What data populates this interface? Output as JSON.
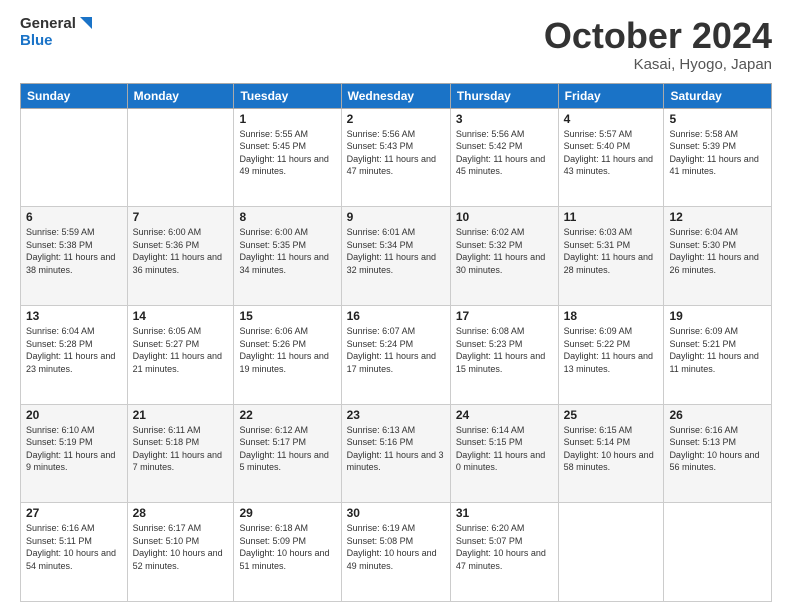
{
  "header": {
    "logo_line1": "General",
    "logo_line2": "Blue",
    "month": "October 2024",
    "location": "Kasai, Hyogo, Japan"
  },
  "weekdays": [
    "Sunday",
    "Monday",
    "Tuesday",
    "Wednesday",
    "Thursday",
    "Friday",
    "Saturday"
  ],
  "weeks": [
    [
      {
        "day": "",
        "sunrise": "",
        "sunset": "",
        "daylight": ""
      },
      {
        "day": "",
        "sunrise": "",
        "sunset": "",
        "daylight": ""
      },
      {
        "day": "1",
        "sunrise": "Sunrise: 5:55 AM",
        "sunset": "Sunset: 5:45 PM",
        "daylight": "Daylight: 11 hours and 49 minutes."
      },
      {
        "day": "2",
        "sunrise": "Sunrise: 5:56 AM",
        "sunset": "Sunset: 5:43 PM",
        "daylight": "Daylight: 11 hours and 47 minutes."
      },
      {
        "day": "3",
        "sunrise": "Sunrise: 5:56 AM",
        "sunset": "Sunset: 5:42 PM",
        "daylight": "Daylight: 11 hours and 45 minutes."
      },
      {
        "day": "4",
        "sunrise": "Sunrise: 5:57 AM",
        "sunset": "Sunset: 5:40 PM",
        "daylight": "Daylight: 11 hours and 43 minutes."
      },
      {
        "day": "5",
        "sunrise": "Sunrise: 5:58 AM",
        "sunset": "Sunset: 5:39 PM",
        "daylight": "Daylight: 11 hours and 41 minutes."
      }
    ],
    [
      {
        "day": "6",
        "sunrise": "Sunrise: 5:59 AM",
        "sunset": "Sunset: 5:38 PM",
        "daylight": "Daylight: 11 hours and 38 minutes."
      },
      {
        "day": "7",
        "sunrise": "Sunrise: 6:00 AM",
        "sunset": "Sunset: 5:36 PM",
        "daylight": "Daylight: 11 hours and 36 minutes."
      },
      {
        "day": "8",
        "sunrise": "Sunrise: 6:00 AM",
        "sunset": "Sunset: 5:35 PM",
        "daylight": "Daylight: 11 hours and 34 minutes."
      },
      {
        "day": "9",
        "sunrise": "Sunrise: 6:01 AM",
        "sunset": "Sunset: 5:34 PM",
        "daylight": "Daylight: 11 hours and 32 minutes."
      },
      {
        "day": "10",
        "sunrise": "Sunrise: 6:02 AM",
        "sunset": "Sunset: 5:32 PM",
        "daylight": "Daylight: 11 hours and 30 minutes."
      },
      {
        "day": "11",
        "sunrise": "Sunrise: 6:03 AM",
        "sunset": "Sunset: 5:31 PM",
        "daylight": "Daylight: 11 hours and 28 minutes."
      },
      {
        "day": "12",
        "sunrise": "Sunrise: 6:04 AM",
        "sunset": "Sunset: 5:30 PM",
        "daylight": "Daylight: 11 hours and 26 minutes."
      }
    ],
    [
      {
        "day": "13",
        "sunrise": "Sunrise: 6:04 AM",
        "sunset": "Sunset: 5:28 PM",
        "daylight": "Daylight: 11 hours and 23 minutes."
      },
      {
        "day": "14",
        "sunrise": "Sunrise: 6:05 AM",
        "sunset": "Sunset: 5:27 PM",
        "daylight": "Daylight: 11 hours and 21 minutes."
      },
      {
        "day": "15",
        "sunrise": "Sunrise: 6:06 AM",
        "sunset": "Sunset: 5:26 PM",
        "daylight": "Daylight: 11 hours and 19 minutes."
      },
      {
        "day": "16",
        "sunrise": "Sunrise: 6:07 AM",
        "sunset": "Sunset: 5:24 PM",
        "daylight": "Daylight: 11 hours and 17 minutes."
      },
      {
        "day": "17",
        "sunrise": "Sunrise: 6:08 AM",
        "sunset": "Sunset: 5:23 PM",
        "daylight": "Daylight: 11 hours and 15 minutes."
      },
      {
        "day": "18",
        "sunrise": "Sunrise: 6:09 AM",
        "sunset": "Sunset: 5:22 PM",
        "daylight": "Daylight: 11 hours and 13 minutes."
      },
      {
        "day": "19",
        "sunrise": "Sunrise: 6:09 AM",
        "sunset": "Sunset: 5:21 PM",
        "daylight": "Daylight: 11 hours and 11 minutes."
      }
    ],
    [
      {
        "day": "20",
        "sunrise": "Sunrise: 6:10 AM",
        "sunset": "Sunset: 5:19 PM",
        "daylight": "Daylight: 11 hours and 9 minutes."
      },
      {
        "day": "21",
        "sunrise": "Sunrise: 6:11 AM",
        "sunset": "Sunset: 5:18 PM",
        "daylight": "Daylight: 11 hours and 7 minutes."
      },
      {
        "day": "22",
        "sunrise": "Sunrise: 6:12 AM",
        "sunset": "Sunset: 5:17 PM",
        "daylight": "Daylight: 11 hours and 5 minutes."
      },
      {
        "day": "23",
        "sunrise": "Sunrise: 6:13 AM",
        "sunset": "Sunset: 5:16 PM",
        "daylight": "Daylight: 11 hours and 3 minutes."
      },
      {
        "day": "24",
        "sunrise": "Sunrise: 6:14 AM",
        "sunset": "Sunset: 5:15 PM",
        "daylight": "Daylight: 11 hours and 0 minutes."
      },
      {
        "day": "25",
        "sunrise": "Sunrise: 6:15 AM",
        "sunset": "Sunset: 5:14 PM",
        "daylight": "Daylight: 10 hours and 58 minutes."
      },
      {
        "day": "26",
        "sunrise": "Sunrise: 6:16 AM",
        "sunset": "Sunset: 5:13 PM",
        "daylight": "Daylight: 10 hours and 56 minutes."
      }
    ],
    [
      {
        "day": "27",
        "sunrise": "Sunrise: 6:16 AM",
        "sunset": "Sunset: 5:11 PM",
        "daylight": "Daylight: 10 hours and 54 minutes."
      },
      {
        "day": "28",
        "sunrise": "Sunrise: 6:17 AM",
        "sunset": "Sunset: 5:10 PM",
        "daylight": "Daylight: 10 hours and 52 minutes."
      },
      {
        "day": "29",
        "sunrise": "Sunrise: 6:18 AM",
        "sunset": "Sunset: 5:09 PM",
        "daylight": "Daylight: 10 hours and 51 minutes."
      },
      {
        "day": "30",
        "sunrise": "Sunrise: 6:19 AM",
        "sunset": "Sunset: 5:08 PM",
        "daylight": "Daylight: 10 hours and 49 minutes."
      },
      {
        "day": "31",
        "sunrise": "Sunrise: 6:20 AM",
        "sunset": "Sunset: 5:07 PM",
        "daylight": "Daylight: 10 hours and 47 minutes."
      },
      {
        "day": "",
        "sunrise": "",
        "sunset": "",
        "daylight": ""
      },
      {
        "day": "",
        "sunrise": "",
        "sunset": "",
        "daylight": ""
      }
    ]
  ]
}
